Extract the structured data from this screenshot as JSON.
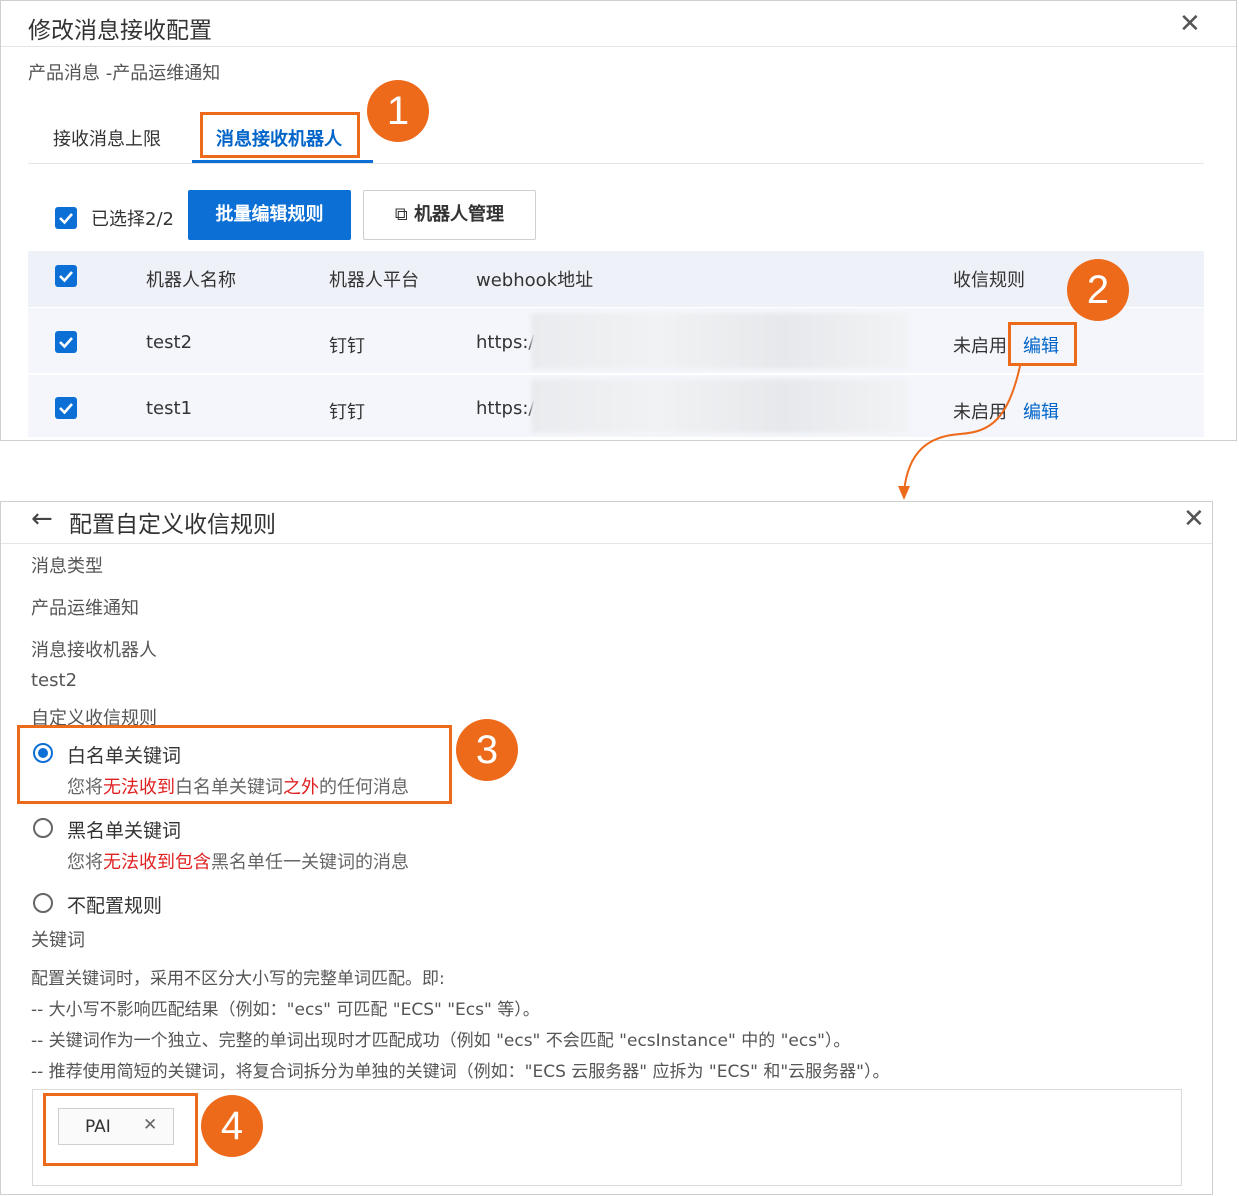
{
  "dialog1": {
    "title": "修改消息接收配置",
    "subtitle": "产品消息 -产品运维通知",
    "tabs": [
      {
        "label": "接收消息上限"
      },
      {
        "label": "消息接收机器人"
      }
    ],
    "selected_text": "已选择2/2",
    "batch_edit_button": "批量编辑规则",
    "robot_manage_button": "机器人管理",
    "table": {
      "headers": [
        "机器人名称",
        "机器人平台",
        "webhook地址",
        "收信规则"
      ],
      "rows": [
        {
          "name": "test2",
          "platform": "钉钉",
          "webhook": "https:/",
          "status": "未启用",
          "action": "编辑"
        },
        {
          "name": "test1",
          "platform": "钉钉",
          "webhook": "https:/",
          "status": "未启用",
          "action": "编辑"
        }
      ]
    }
  },
  "dialog2": {
    "title": "配置自定义收信规则",
    "msg_type_label": "消息类型",
    "msg_type_value": "产品运维通知",
    "robot_label": "消息接收机器人",
    "robot_value": "test2",
    "rule_label": "自定义收信规则",
    "options": [
      {
        "label": "白名单关键词",
        "desc_pre": "您将",
        "desc_red1": "无法收到",
        "desc_mid": "白名单关键词",
        "desc_red2": "之外",
        "desc_post": "的任何消息"
      },
      {
        "label": "黑名单关键词",
        "desc_pre": "您将",
        "desc_red1": "无法收到包含",
        "desc_post": "黑名单任一关键词的消息"
      },
      {
        "label": "不配置规则"
      }
    ],
    "keyword_label": "关键词",
    "notes": [
      "配置关键词时，采用不区分大小写的完整单词匹配。即:",
      "-- 大小写不影响匹配结果（例如：\"ecs\" 可匹配 \"ECS\" \"Ecs\" 等）。",
      "-- 关键词作为一个独立、完整的单词出现时才匹配成功（例如 \"ecs\" 不会匹配 \"ecsInstance\" 中的 \"ecs\"）。",
      "-- 推荐使用简短的关键词，将复合词拆分为单独的关键词（例如：\"ECS 云服务器\" 应拆为 \"ECS\" 和\"云服务器\"）。"
    ],
    "tag": "PAI"
  },
  "badges": [
    "1",
    "2",
    "3",
    "4"
  ],
  "colors": {
    "accent": "#0b6fd6",
    "annotation": "#ee6a1b",
    "warning_text": "#e02020"
  }
}
